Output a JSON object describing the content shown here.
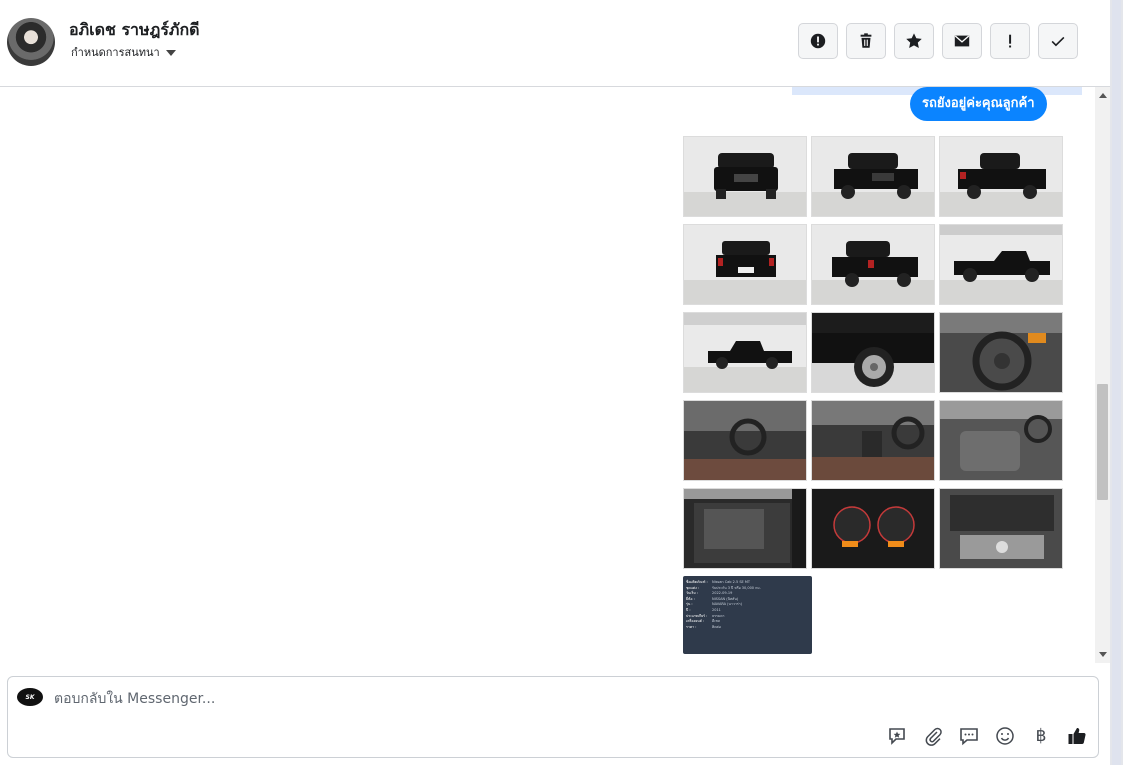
{
  "header": {
    "contact_name": "อภิเดช ราษฎร์ภักดี",
    "assign_label": "กำหนดการสนทนา",
    "actions": [
      {
        "name": "spam-button",
        "icon": "alert-circle-icon"
      },
      {
        "name": "delete-button",
        "icon": "trash-icon"
      },
      {
        "name": "star-button",
        "icon": "star-icon"
      },
      {
        "name": "mark-unread-button",
        "icon": "envelope-icon"
      },
      {
        "name": "priority-button",
        "icon": "exclamation-icon"
      },
      {
        "name": "done-button",
        "icon": "check-icon"
      }
    ]
  },
  "thread": {
    "bubble_text": "รถยังอยู่ค่ะคุณลูกค้า",
    "photos": [
      "car-front-view",
      "car-front-three-quarter",
      "car-rear-three-quarter",
      "car-rear-view",
      "car-rear-three-quarter-left",
      "car-side-right",
      "car-side-left",
      "car-wheel-closeup",
      "car-steering-wheel",
      "car-dashboard-left",
      "car-center-console",
      "car-rear-seats",
      "car-door-panel",
      "car-gauge-cluster",
      "car-engine-bay"
    ],
    "spec_card": {
      "rows": [
        {
          "k": "ชื่อผลิตภัณฑ์ :",
          "v": "Nissan Cab 2.5 SE MT"
        },
        {
          "k": "ชุดแต่ง :",
          "v": "รับประกัน 3 ปี หรือ 30,000 กม."
        },
        {
          "k": "วันเริ่ม :",
          "v": "2022-09-19"
        },
        {
          "k": "ยี่ห้อ :",
          "v": "NISSAN (นิสสัน)"
        },
        {
          "k": "รุ่น :",
          "v": "NAVARA (นาวาร่า)"
        },
        {
          "k": "ปี :",
          "v": "2011"
        },
        {
          "k": "ประเภทเกียร์ :",
          "v": "ธรรมดา"
        },
        {
          "k": "เครื่องยนต์ :",
          "v": "ดีเซล"
        },
        {
          "k": "ราคา :",
          "v": "ติดต่อ"
        }
      ]
    }
  },
  "composer": {
    "page_avatar_text": "SK",
    "placeholder": "ตอบกลับใน Messenger...",
    "tools": [
      "saved-reply-icon",
      "attachment-icon",
      "chat-bubbles-icon",
      "emoji-icon",
      "baht-icon",
      "thumbs-up-icon"
    ],
    "baht_symbol": "฿"
  }
}
